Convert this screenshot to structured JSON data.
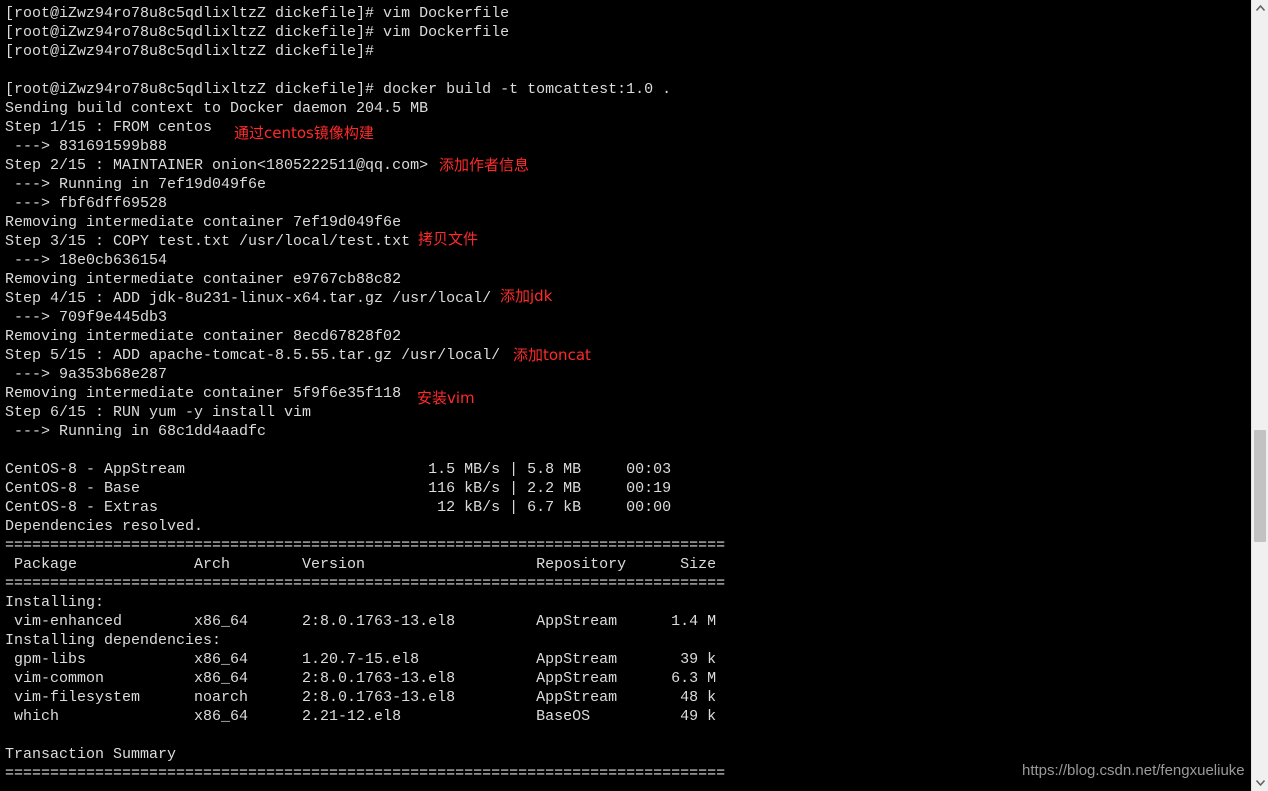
{
  "terminal": {
    "lines": [
      "[root@iZwz94ro78u8c5qdlixltzZ dickefile]# vim Dockerfile",
      "[root@iZwz94ro78u8c5qdlixltzZ dickefile]# vim Dockerfile",
      "[root@iZwz94ro78u8c5qdlixltzZ dickefile]#",
      "",
      "[root@iZwz94ro78u8c5qdlixltzZ dickefile]# docker build -t tomcattest:1.0 .",
      "Sending build context to Docker daemon 204.5 MB",
      "Step 1/15 : FROM centos",
      " ---> 831691599b88",
      "Step 2/15 : MAINTAINER onion<1805222511@qq.com>",
      " ---> Running in 7ef19d049f6e",
      " ---> fbf6dff69528",
      "Removing intermediate container 7ef19d049f6e",
      "Step 3/15 : COPY test.txt /usr/local/test.txt",
      " ---> 18e0cb636154",
      "Removing intermediate container e9767cb88c82",
      "Step 4/15 : ADD jdk-8u231-linux-x64.tar.gz /usr/local/",
      " ---> 709f9e445db3",
      "Removing intermediate container 8ecd67828f02",
      "Step 5/15 : ADD apache-tomcat-8.5.55.tar.gz /usr/local/",
      " ---> 9a353b68e287",
      "Removing intermediate container 5f9f6e35f118",
      "Step 6/15 : RUN yum -y install vim",
      " ---> Running in 68c1dd4aadfc",
      "",
      "CentOS-8 - AppStream                           1.5 MB/s | 5.8 MB     00:03",
      "CentOS-8 - Base                                116 kB/s | 2.2 MB     00:19",
      "CentOS-8 - Extras                               12 kB/s | 6.7 kB     00:00",
      "Dependencies resolved.",
      "================================================================================",
      " Package             Arch        Version                   Repository      Size",
      "================================================================================",
      "Installing:",
      " vim-enhanced        x86_64      2:8.0.1763-13.el8         AppStream      1.4 M",
      "Installing dependencies:",
      " gpm-libs            x86_64      1.20.7-15.el8             AppStream       39 k",
      " vim-common          x86_64      2:8.0.1763-13.el8         AppStream      6.3 M",
      " vim-filesystem      noarch      2:8.0.1763-13.el8         AppStream       48 k",
      " which               x86_64      2.21-12.el8               BaseOS          49 k",
      "",
      "Transaction Summary",
      "================================================================================"
    ]
  },
  "annotations": {
    "from_centos": "通过centos镜像构建",
    "maintainer": "添加作者信息",
    "copy_file": "拷贝文件",
    "add_jdk": "添加jdk",
    "add_tomcat": "添加toncat",
    "install_vim": "安装vim"
  },
  "watermark": "https://blog.csdn.net/fengxueliuke",
  "colors": {
    "background": "#000000",
    "text": "#dcdcdc",
    "annotation": "#ff2a2a",
    "scrollbar": "#f0f0f0"
  }
}
